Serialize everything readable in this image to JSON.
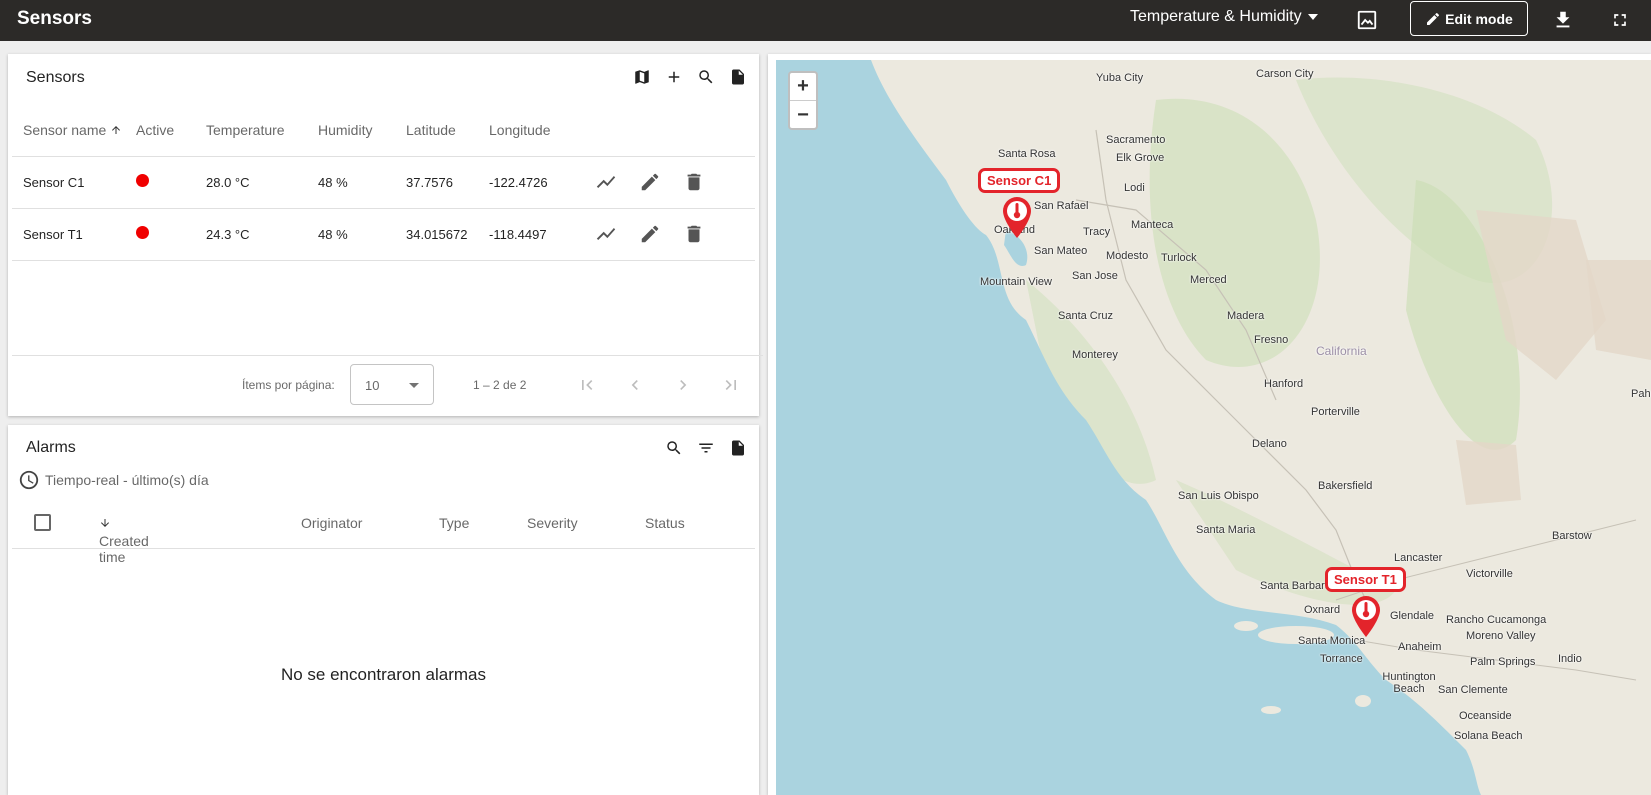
{
  "header": {
    "title": "Sensors",
    "state_label": "Temperature & Humidity",
    "edit_label": "Edit mode"
  },
  "sensors": {
    "title": "Sensors",
    "columns": [
      "Sensor name",
      "Active",
      "Temperature",
      "Humidity",
      "Latitude",
      "Longitude"
    ],
    "rows": [
      {
        "name": "Sensor C1",
        "temperature": "28.0 °C",
        "humidity": "48 %",
        "latitude": "37.7576",
        "longitude": "-122.4726"
      },
      {
        "name": "Sensor T1",
        "temperature": "24.3 °C",
        "humidity": "48 %",
        "latitude": "34.015672",
        "longitude": "-118.4497"
      }
    ],
    "paginator": {
      "items_label": "Ítems por página:",
      "page_size": "10",
      "range": "1 – 2 de 2"
    }
  },
  "alarms": {
    "title": "Alarms",
    "timewindow": "Tiempo-real - último(s) día",
    "columns": [
      "Created time",
      "Originator",
      "Type",
      "Severity",
      "Status"
    ],
    "empty": "No se encontraron alarmas"
  },
  "map": {
    "zoom_in": "+",
    "zoom_out": "−",
    "markers": [
      "Sensor C1",
      "Sensor T1"
    ],
    "places": [
      "Yuba City",
      "Carson City",
      "Sacramento",
      "Elk Grove",
      "Santa Rosa",
      "Lodi",
      "San Rafael",
      "Oakland",
      "Tracy",
      "Manteca",
      "San Mateo",
      "Modesto",
      "Turlock",
      "San Jose",
      "Mountain View",
      "Merced",
      "Santa Cruz",
      "Madera",
      "Fresno",
      "California",
      "Monterey",
      "Hanford",
      "Porterville",
      "Delano",
      "Bakersfield",
      "San Luis Obispo",
      "Santa Maria",
      "Lancaster",
      "Barstow",
      "Victorville",
      "Santa Barbara",
      "Oxnard",
      "Glendale",
      "Rancho Cucamonga",
      "Moreno Valley",
      "Santa Monica",
      "Anaheim",
      "Palm Springs",
      "Indio",
      "Torrance",
      "Huntington Beach",
      "San Clemente",
      "Oceanside",
      "Solana Beach",
      "Pahru"
    ]
  },
  "colors": {
    "topbar": "#2c2a28",
    "marker": "#e3242b",
    "active_dot": "#f00000",
    "sea": "#aad3df"
  }
}
